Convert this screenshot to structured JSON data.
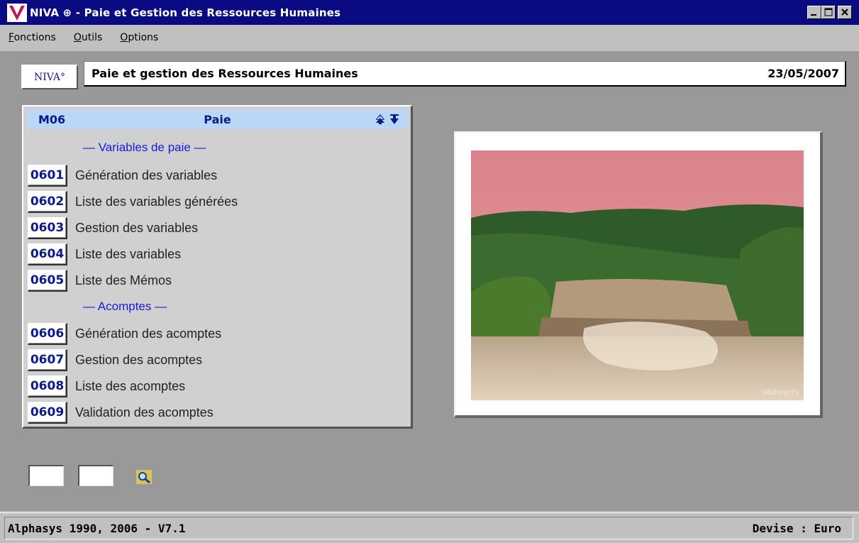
{
  "window": {
    "title": "NIVA ⊕ - Paie et Gestion des Ressources Humaines"
  },
  "menubar": {
    "items": [
      {
        "label": "Fonctions",
        "accel": "F",
        "rest": "onctions"
      },
      {
        "label": "Outils",
        "accel": "O",
        "rest": "utils"
      },
      {
        "label": "Options",
        "accel": "O",
        "rest": "ptions"
      }
    ]
  },
  "header": {
    "badge": "NIVA°",
    "title": "Paie et gestion des Ressources Humaines",
    "date": "23/05/2007"
  },
  "panel": {
    "code": "M06",
    "title": "Paie",
    "arrows": "⯭⯯",
    "sections": [
      {
        "label": "— Variables de paie —"
      },
      {
        "label": "— Acomptes —"
      }
    ],
    "items": [
      {
        "code": "0601",
        "label": "Génération des variables"
      },
      {
        "code": "0602",
        "label": "Liste des variables générées"
      },
      {
        "code": "0603",
        "label": "Gestion des variables"
      },
      {
        "code": "0604",
        "label": "Liste des variables"
      },
      {
        "code": "0605",
        "label": "Liste des Mémos"
      },
      {
        "code": "0606",
        "label": "Génération des acomptes"
      },
      {
        "code": "0607",
        "label": "Gestion des acomptes"
      },
      {
        "code": "0608",
        "label": "Liste des acomptes"
      },
      {
        "code": "0609",
        "label": "Validation des acomptes"
      }
    ]
  },
  "photo": {
    "watermark": "WEBSHOTS"
  },
  "bottom": {
    "input1": "",
    "input2": "",
    "search_icon": "search-icon"
  },
  "status": {
    "left": "Alphasys 1990, 2006 - V7.1",
    "right": "Devise : Euro"
  },
  "colors": {
    "titlebar": "#0a0a82",
    "main_bg": "#999999",
    "panel_header": "#bcd7f5",
    "code_text": "#0a1a8a",
    "section_text": "#1a1ad8"
  }
}
